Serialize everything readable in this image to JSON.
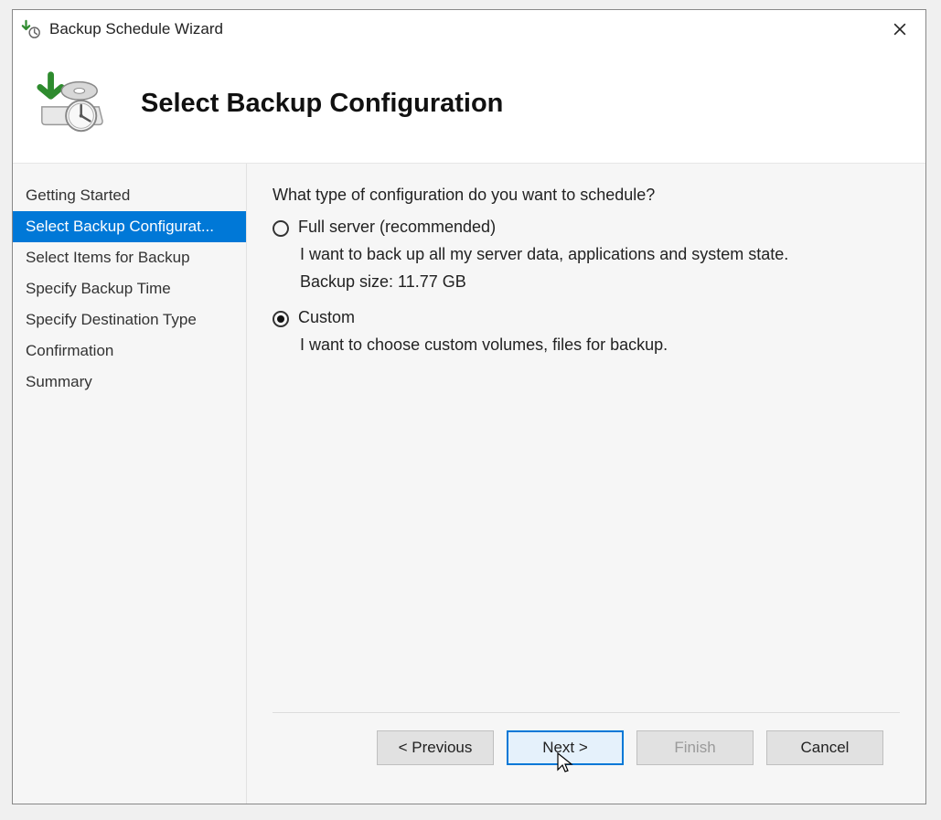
{
  "window": {
    "title": "Backup Schedule Wizard"
  },
  "header": {
    "page_title": "Select Backup Configuration"
  },
  "sidebar": {
    "steps": [
      "Getting Started",
      "Select Backup Configurat...",
      "Select Items for Backup",
      "Specify Backup Time",
      "Specify Destination Type",
      "Confirmation",
      "Summary"
    ],
    "active_index": 1
  },
  "content": {
    "prompt": "What type of configuration do you want to schedule?",
    "options": [
      {
        "label": "Full server (recommended)",
        "description": "I want to back up all my server data, applications and system state.",
        "extra": "Backup size: 11.77 GB",
        "selected": false
      },
      {
        "label": "Custom",
        "description": "I want to choose custom volumes, files for backup.",
        "extra": "",
        "selected": true
      }
    ]
  },
  "footer": {
    "previous": "< Previous",
    "next": "Next >",
    "finish": "Finish",
    "cancel": "Cancel"
  }
}
